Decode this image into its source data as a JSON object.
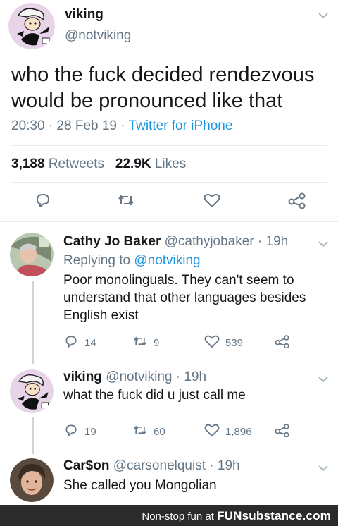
{
  "main_tweet": {
    "display_name": "viking",
    "handle": "@notviking",
    "text": "who the fuck decided rendezvous would be pronounced like that",
    "timestamp": "20:30 · 28 Feb 19 · ",
    "source": "Twitter for iPhone",
    "retweets_count": "3,188",
    "retweets_label": "Retweets",
    "likes_count": "22.9K",
    "likes_label": "Likes"
  },
  "replies": [
    {
      "display_name": "Cathy Jo Baker",
      "handle": "@cathyjobaker",
      "time": "· 19h",
      "replying_prefix": "Replying to ",
      "replying_to": "@notviking",
      "text": "Poor monolinguals. They can't seem to understand that other languages besides English exist",
      "reply_count": "14",
      "retweet_count": "9",
      "like_count": "539"
    },
    {
      "display_name": "viking",
      "handle": "@notviking",
      "time": "· 19h",
      "text": "what the fuck did u just call me",
      "reply_count": "19",
      "retweet_count": "60",
      "like_count": "1,896"
    },
    {
      "display_name": "Car$on",
      "handle": "@carsonelquist",
      "time": "· 19h",
      "text": "She called you Mongolian"
    }
  ],
  "footer": {
    "prefix": "Non-stop fun at ",
    "brand": "FUNsubstance.com"
  },
  "colors": {
    "link": "#1b95e0",
    "muted": "#657786",
    "text": "#14171a",
    "footer_bg": "#2b2b2b"
  }
}
